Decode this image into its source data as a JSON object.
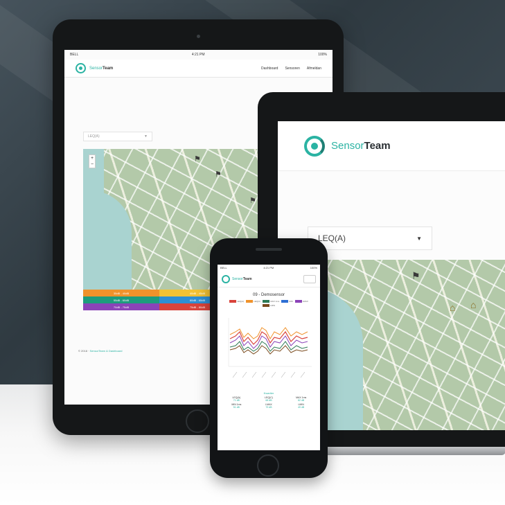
{
  "tablet": {
    "status": {
      "carrier": "BELL",
      "time": "4:21 PM",
      "battery": "100%"
    },
    "brand": {
      "part1": "Sensor",
      "part2": "Team"
    },
    "menu": [
      "Dashboard",
      "Sensoren",
      "Afmeldan"
    ],
    "select_value": "LEQ(A)",
    "zoom_in": "+",
    "zoom_out": "−",
    "legend": [
      {
        "label": "35dB - 40dB",
        "color": "#f0922b"
      },
      {
        "label": "40dB - 45dB",
        "color": "#f2c234"
      },
      {
        "label": "",
        "color": "#f2c234"
      },
      {
        "label": "55dB - 60dB",
        "color": "#1d9c7d"
      },
      {
        "label": "60dB - 65dB",
        "color": "#2d8fd4"
      },
      {
        "label": "",
        "color": "#2d8fd4"
      },
      {
        "label": "70dB - 75dB",
        "color": "#8b43b8"
      },
      {
        "label": "75dB - 80dB",
        "color": "#d9433b"
      },
      {
        "label": "",
        "color": "#d9433b"
      }
    ],
    "footer": {
      "prefix": "© 2018 ·",
      "link": "SensorTeam & Dashboard"
    }
  },
  "laptop": {
    "brand": {
      "part1": "Sensor",
      "part2": "Team"
    },
    "select_value": "LEQ(A)"
  },
  "phone": {
    "status": {
      "carrier": "BELL",
      "time": "4:21 PM",
      "battery": "100%"
    },
    "brand": {
      "part1": "Sensor",
      "part2": "Team"
    },
    "chart_title": "09 - Demosensor",
    "legend": [
      {
        "label": "LEQ(A)",
        "color": "#d9433b"
      },
      {
        "label": "LEQ(C)",
        "color": "#f0922b"
      },
      {
        "label": "MAX 1ms",
        "color": "#2d7a55"
      },
      {
        "label": "MIN",
        "color": "#2d6fd4"
      },
      {
        "label": "LMAX",
        "color": "#8b43b8"
      },
      {
        "label": "LMIN",
        "color": "#7a4a1d"
      }
    ],
    "subtitle": "Kwartier",
    "stats": [
      {
        "label": "LEQ(A)",
        "value": "71 dB"
      },
      {
        "label": "LEQ(C)",
        "value": "68 dB"
      },
      {
        "label": "MAX 1ms",
        "value": "82 dB"
      },
      {
        "label": "MIN 1ms",
        "value": "51 dB"
      },
      {
        "label": "LMAX",
        "value": "79 dB"
      },
      {
        "label": "LMIN",
        "value": "49 dB"
      }
    ]
  },
  "colors": {
    "accent": "#2bb3a3",
    "device": "#151718"
  }
}
